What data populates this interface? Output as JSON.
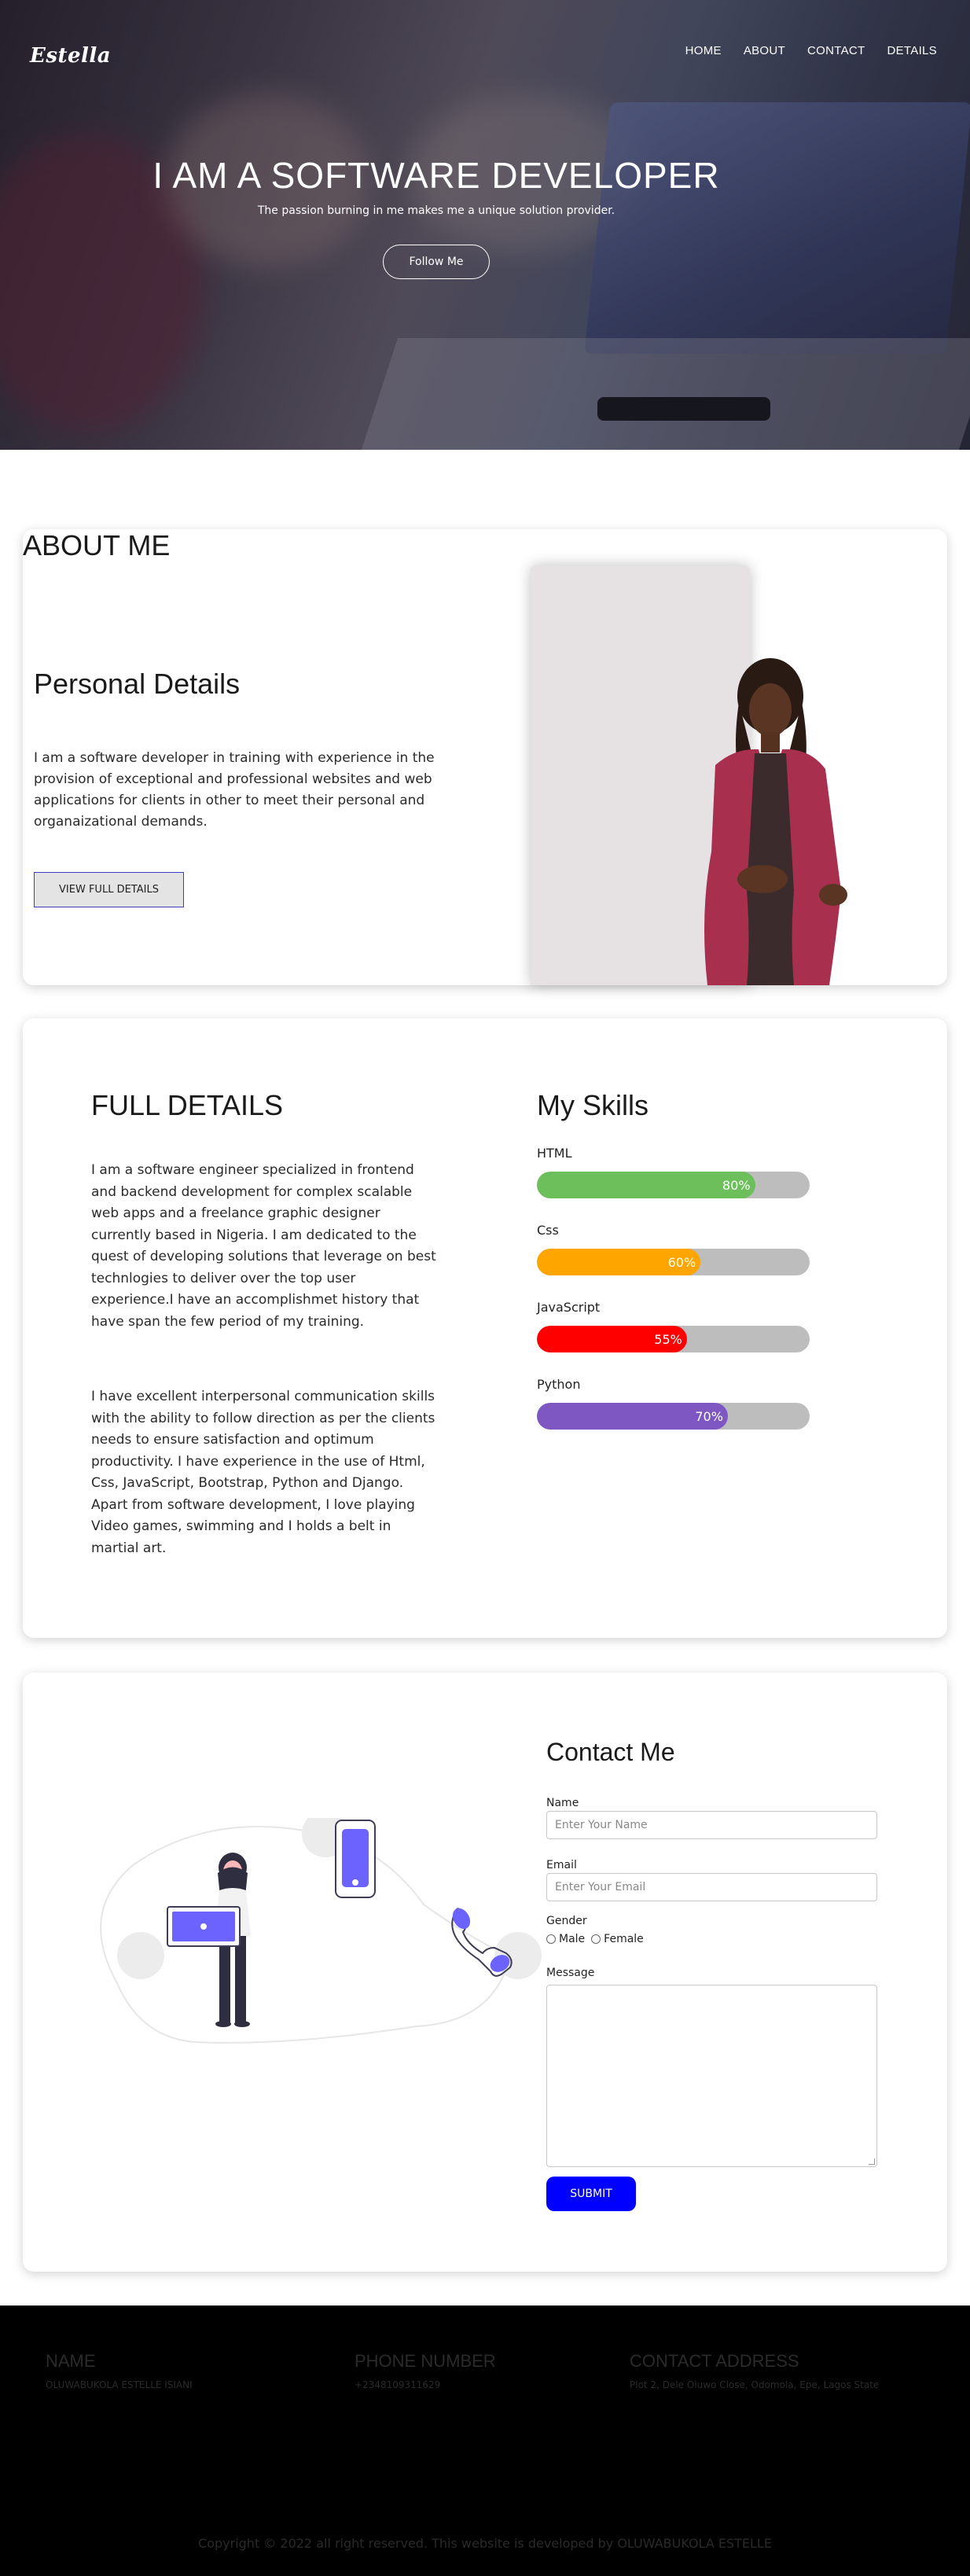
{
  "brand": {
    "logo": "Estella"
  },
  "nav": {
    "items": [
      "HOME",
      "ABOUT",
      "CONTACT",
      "DETAILS"
    ]
  },
  "hero": {
    "title": "I AM A SOFTWARE DEVELOPER",
    "subtitle": "The passion burning in me makes me a unique solution provider.",
    "button": "Follow Me"
  },
  "about": {
    "title": "ABOUT ME",
    "personal_title": "Personal Details",
    "text": "I am a software developer in training with experience in the provision of exceptional and professional websites and web applications for clients in other to meet their personal and organaizational demands.",
    "button": "VIEW FULL DETAILS"
  },
  "full": {
    "title": "FULL DETAILS",
    "p1": "I am a software engineer specialized in frontend and backend development for complex scalable web apps and a freelance graphic designer currently based in Nigeria. I am dedicated to the quest of developing solutions that leverage on best technlogies to deliver over the top user experience.I have an accomplishmet history that have span the few period of my training.",
    "p2": "I have excellent interpersonal communication skills with the ability to follow direction as per the clients needs to ensure satisfaction and optimum productivity. I have experience in the use of Html, Css, JavaScript, Bootstrap, Python and Django. Apart from software development, I love playing Video games, swimming and I holds a belt in martial art."
  },
  "skills": {
    "title": "My Skills",
    "items": [
      {
        "name": "HTML",
        "label": "80%",
        "value": 80,
        "color": "#6cbf5a"
      },
      {
        "name": "Css",
        "label": "60%",
        "value": 60,
        "color": "#ffa500"
      },
      {
        "name": "JavaScript",
        "label": "55%",
        "value": 55,
        "color": "#ff0000"
      },
      {
        "name": "Python",
        "label": "70%",
        "value": 70,
        "color": "#7e57c2"
      }
    ]
  },
  "contact": {
    "title": "Contact Me",
    "name_label": "Name",
    "name_placeholder": "Enter Your Name",
    "email_label": "Email",
    "email_placeholder": "Enter Your Email",
    "gender_label": "Gender",
    "gender_options": [
      "Male",
      "Female"
    ],
    "message_label": "Message",
    "submit": "SUBMIT"
  },
  "footer": {
    "name_heading": "NAME",
    "name_value": "OLUWABUKOLA ESTELLE ISIANI",
    "phone_heading": "PHONE NUMBER",
    "phone_value": "+2348109311629",
    "address_heading": "CONTACT ADDRESS",
    "address_value": "Plot 2, Dele Oluwo Close, Odomola, Epe, Lagos State",
    "copyright": "Copyright © 2022 all right reserved. This website is developed by OLUWABUKOLA ESTELLE"
  },
  "colors": {
    "accent_blue": "#0000ff",
    "footer_bg": "#000000"
  }
}
